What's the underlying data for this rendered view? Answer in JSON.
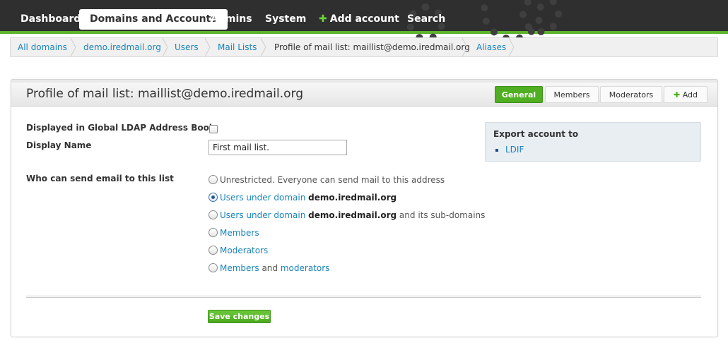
{
  "topnav": {
    "items": [
      {
        "label": "Dashboard"
      },
      {
        "label": "Domains and Accounts",
        "active": true
      },
      {
        "label": "Admins"
      },
      {
        "label": "System"
      },
      {
        "label": "Add account",
        "icon": "plus-icon"
      },
      {
        "label": "Search"
      }
    ]
  },
  "breadcrumb": {
    "items": [
      {
        "label": "All domains",
        "link": true
      },
      {
        "label": "demo.iredmail.org",
        "link": true
      },
      {
        "label": "Users",
        "link": true
      },
      {
        "label": "Mail Lists",
        "link": true
      },
      {
        "label": "Profile of mail list: maillist@demo.iredmail.org",
        "link": false
      },
      {
        "label": "Aliases",
        "link": true
      }
    ]
  },
  "panel": {
    "title": "Profile of mail list: maillist@demo.iredmail.org",
    "tabs": [
      {
        "label": "General",
        "active": true
      },
      {
        "label": "Members"
      },
      {
        "label": "Moderators"
      },
      {
        "label": "Add",
        "icon": "plus-icon"
      }
    ]
  },
  "form": {
    "global_ldap_label": "Displayed in Global LDAP Address Book",
    "global_ldap_checked": false,
    "display_name_label": "Display Name",
    "display_name_value": "First mail list.",
    "who_can_send_label": "Who can send email to this list",
    "options": {
      "unrestricted": "Unrestricted. Everyone can send mail to this address",
      "domain_users_link": "Users under domain",
      "domain_name": "demo.iredmail.org",
      "subdomain_users_link": "Users under domain",
      "subdomain_name": "demo.iredmail.org",
      "subdomain_suffix": "and its sub-domains",
      "members": "Members",
      "moderators": "Moderators",
      "members_and_mod_members": "Members",
      "members_and_mod_and": "and",
      "members_and_mod_moderators": "moderators"
    },
    "selected_option": "domain_users",
    "save_label": "Save changes"
  },
  "export": {
    "title": "Export account to",
    "items": [
      "LDIF"
    ]
  },
  "colors": {
    "accent_green": "#5db32c",
    "link_blue": "#1a84b8",
    "nav_dark": "#2f2f2f"
  }
}
